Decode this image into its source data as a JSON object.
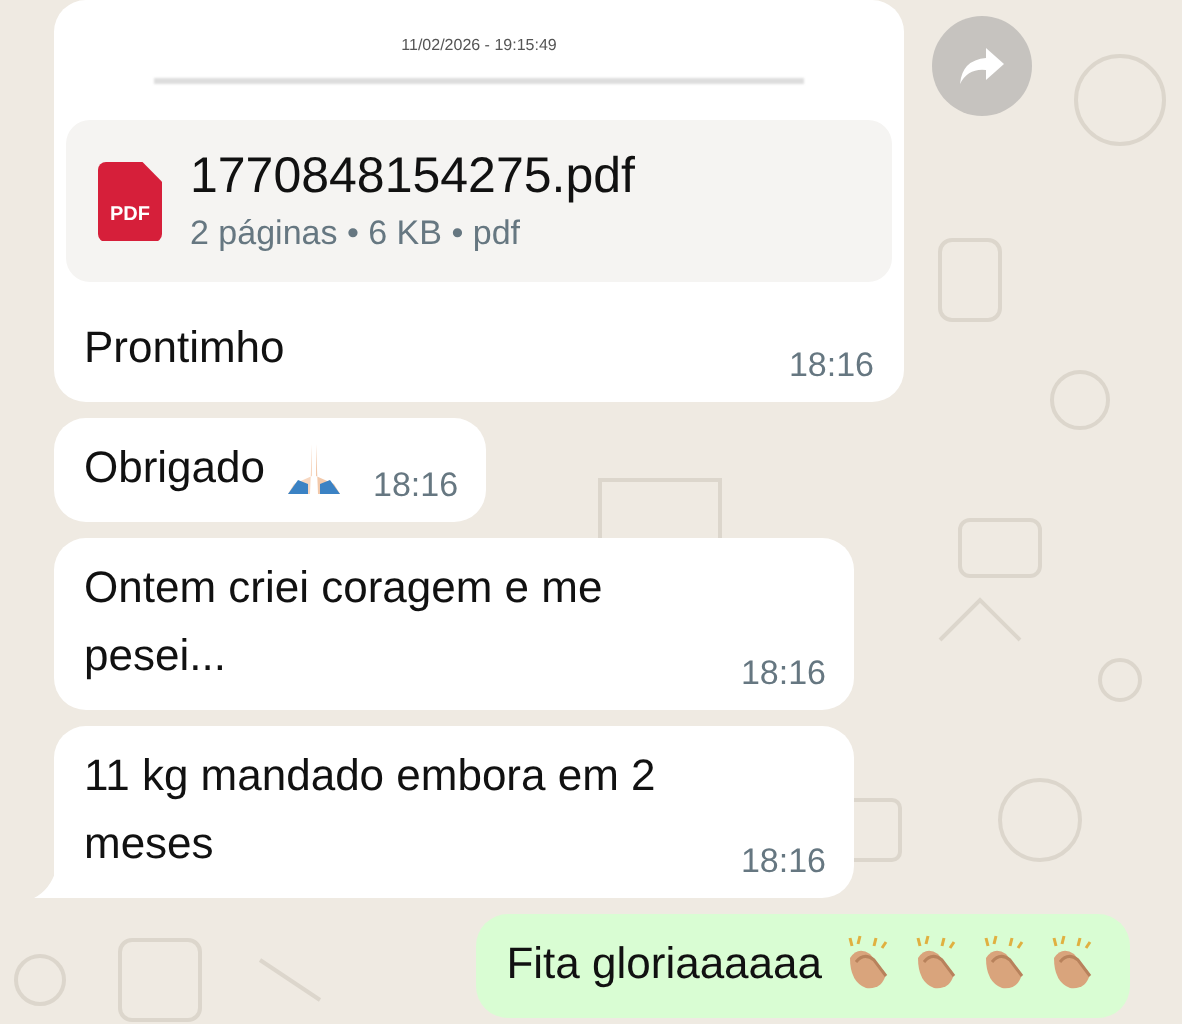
{
  "messages": [
    {
      "kind": "document",
      "outgoing": false,
      "preview_date": "11/02/2026 - 19:15:49",
      "file_badge": "PDF",
      "file_name": "1770848154275.pdf",
      "file_meta": "2 páginas • 6 KB • pdf",
      "text": "Prontimho",
      "time": "18:16",
      "forward": true,
      "tail": false
    },
    {
      "kind": "text",
      "outgoing": false,
      "text": "Obrigado",
      "emojis": [
        {
          "kind": "pray"
        }
      ],
      "time": "18:16",
      "tail": false
    },
    {
      "kind": "text",
      "outgoing": false,
      "text": "Ontem criei coragem e me pesei...",
      "time": "18:16",
      "tail": false
    },
    {
      "kind": "text",
      "outgoing": false,
      "text": "11 kg mandado embora em 2 meses",
      "time": "18:16",
      "tail": true
    },
    {
      "kind": "text",
      "outgoing": true,
      "text": "Fita gloriaaaaaa",
      "emojis": [
        {
          "kind": "clap"
        },
        {
          "kind": "clap"
        },
        {
          "kind": "clap"
        },
        {
          "kind": "clap"
        }
      ],
      "tail": false
    }
  ]
}
